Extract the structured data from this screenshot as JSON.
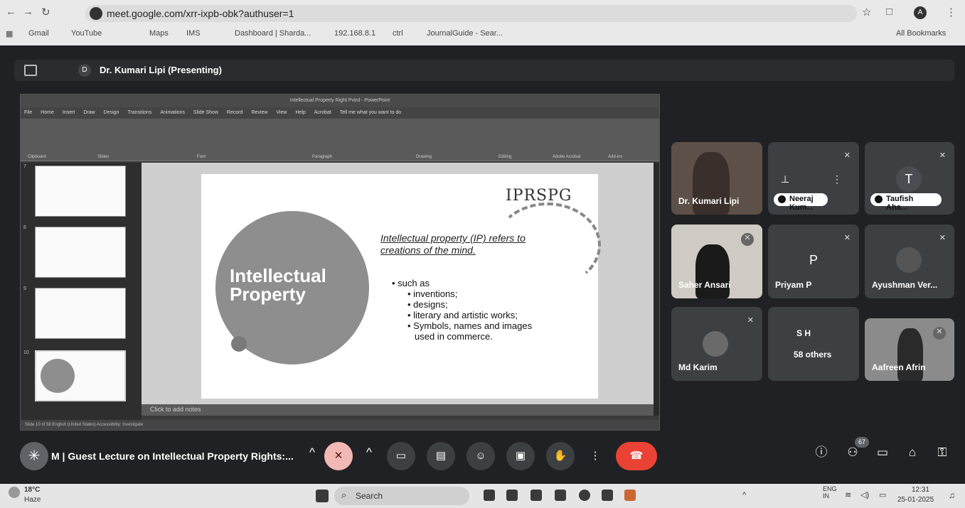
{
  "browser": {
    "url": "meet.google.com/xrr-ixpb-obk?authuser=1",
    "bookmarks": [
      "Gmail",
      "YouTube",
      "Maps",
      "IMS",
      "Dashboard | Sharda...",
      "192.168.8.1",
      "ctrl",
      "JournalGuide - Sear..."
    ],
    "all_bookmarks": "All Bookmarks",
    "profile_initial": "A"
  },
  "presenting": {
    "initial": "D",
    "label": "Dr. Kumari Lipi (Presenting)"
  },
  "ppt": {
    "title": "Intellectual Property Right Pvtrd - PowerPoint",
    "tabs": [
      "File",
      "Home",
      "Insert",
      "Draw",
      "Design",
      "Transitions",
      "Animations",
      "Slide Show",
      "Record",
      "Review",
      "View",
      "Help",
      "Acrobat",
      "Tell me what you want to do"
    ],
    "groups": [
      "Clipboard",
      "Slides",
      "Font",
      "Paragraph",
      "Drawing",
      "Editing",
      "Adobe Acrobat",
      "Add-ins"
    ],
    "slide_numbers": [
      "7",
      "8",
      "9",
      "10"
    ],
    "notes_placeholder": "Click to add notes",
    "status": "Slide 10 of 58   English (United States)   Accessibility: Investigate"
  },
  "slide": {
    "circle_text_1": "Intellectual",
    "circle_text_2": "Property",
    "logo": "IPRSPG",
    "heading_1": "Intellectual property (IP) refers to",
    "heading_2": "creations of the mind.",
    "lead": "• such as",
    "items": [
      "• inventions;",
      "• designs;",
      "• literary and artistic works;",
      "• Symbols, names and images",
      "used in commerce."
    ]
  },
  "participants": [
    {
      "name": "Dr. Kumari Lipi"
    },
    {
      "name": "Neeraj Kum..."
    },
    {
      "name": "Taufish Aha...",
      "initial": "T"
    },
    {
      "name": "Saher Ansari"
    },
    {
      "name": "Priyam P",
      "initial": "P"
    },
    {
      "name": "Ayushman Ver..."
    },
    {
      "name": "Md Karim"
    },
    {
      "name": "58 others",
      "initials": "S   H"
    },
    {
      "name": "Aafreen Afrin"
    }
  ],
  "controls": {
    "meeting_initial": "M",
    "meeting_title": "Guest Lecture on Intellectual Property Rights:...",
    "people_count": "67"
  },
  "taskbar": {
    "weather_temp": "18°C",
    "weather_desc": "Haze",
    "search": "Search",
    "lang_1": "ENG",
    "lang_2": "IN",
    "time": "12:31",
    "date": "25-01-2025"
  }
}
